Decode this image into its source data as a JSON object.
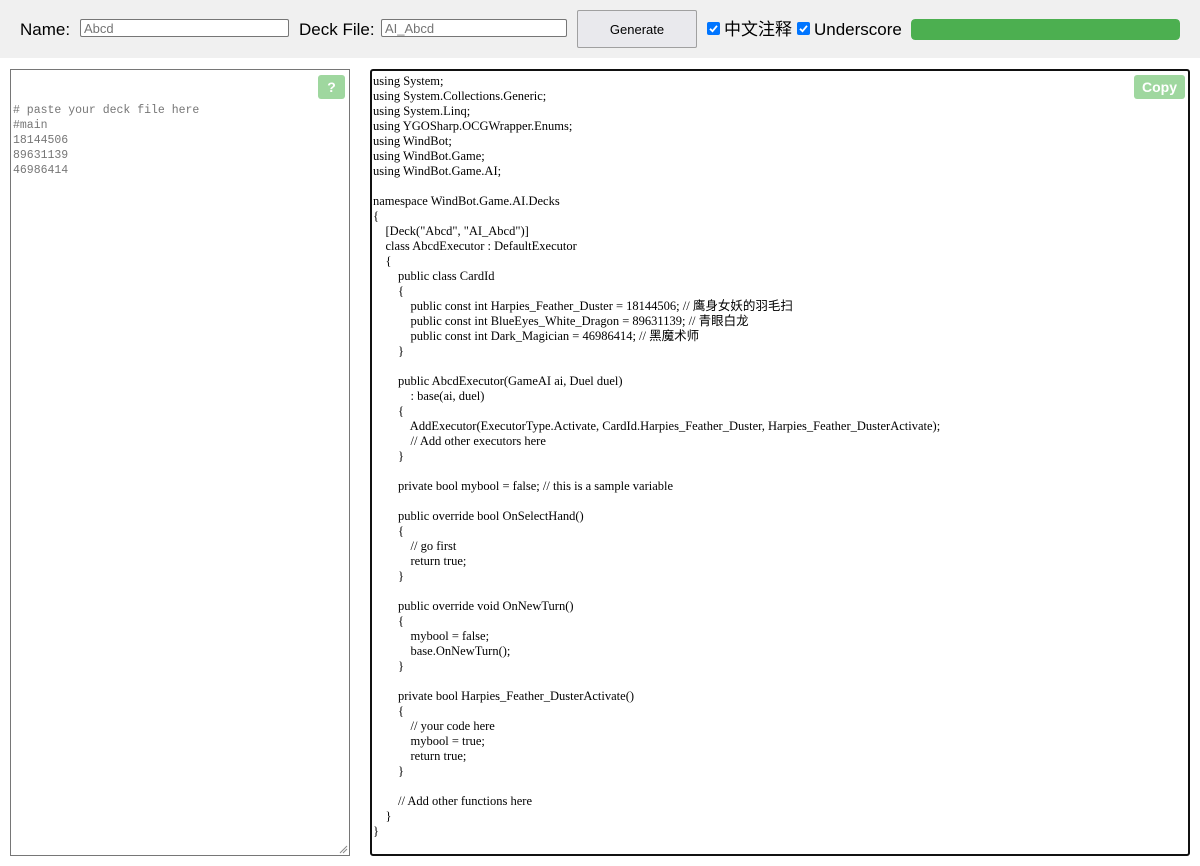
{
  "toolbar": {
    "name_label": "Name:",
    "name_placeholder": "Abcd",
    "deck_file_label": "Deck File:",
    "deck_file_placeholder": "AI_Abcd",
    "generate_label": "Generate",
    "chinese_comments_label": "中文注释",
    "chinese_comments_checked": true,
    "underscore_label": "Underscore",
    "underscore_checked": true,
    "progress_percent": 100,
    "progress_color": "#4caf50"
  },
  "deck_input": {
    "placeholder_lines": [
      "# paste your deck file here",
      "#main",
      "18144506",
      "89631139",
      "46986414"
    ],
    "help_label": "?"
  },
  "code_output": {
    "copy_label": "Copy",
    "lines": [
      "using System;",
      "using System.Collections.Generic;",
      "using System.Linq;",
      "using YGOSharp.OCGWrapper.Enums;",
      "using WindBot;",
      "using WindBot.Game;",
      "using WindBot.Game.AI;",
      "",
      "namespace WindBot.Game.AI.Decks",
      "{",
      "    [Deck(\"Abcd\", \"AI_Abcd\")]",
      "    class AbcdExecutor : DefaultExecutor",
      "    {",
      "        public class CardId",
      "        {",
      "            public const int Harpies_Feather_Duster = 18144506; // 鹰身女妖的羽毛扫",
      "            public const int BlueEyes_White_Dragon = 89631139; // 青眼白龙",
      "            public const int Dark_Magician = 46986414; // 黑魔术师",
      "        }",
      "",
      "        public AbcdExecutor(GameAI ai, Duel duel)",
      "            : base(ai, duel)",
      "        {",
      "            AddExecutor(ExecutorType.Activate, CardId.Harpies_Feather_Duster, Harpies_Feather_DusterActivate);",
      "            // Add other executors here",
      "        }",
      "",
      "        private bool mybool = false; // this is a sample variable",
      "",
      "        public override bool OnSelectHand()",
      "        {",
      "            // go first",
      "            return true;",
      "        }",
      "",
      "        public override void OnNewTurn()",
      "        {",
      "            mybool = false;",
      "            base.OnNewTurn();",
      "        }",
      "",
      "        private bool Harpies_Feather_DusterActivate()",
      "        {",
      "            // your code here",
      "            mybool = true;",
      "            return true;",
      "        }",
      "",
      "        // Add other functions here",
      "    }",
      "}"
    ]
  }
}
